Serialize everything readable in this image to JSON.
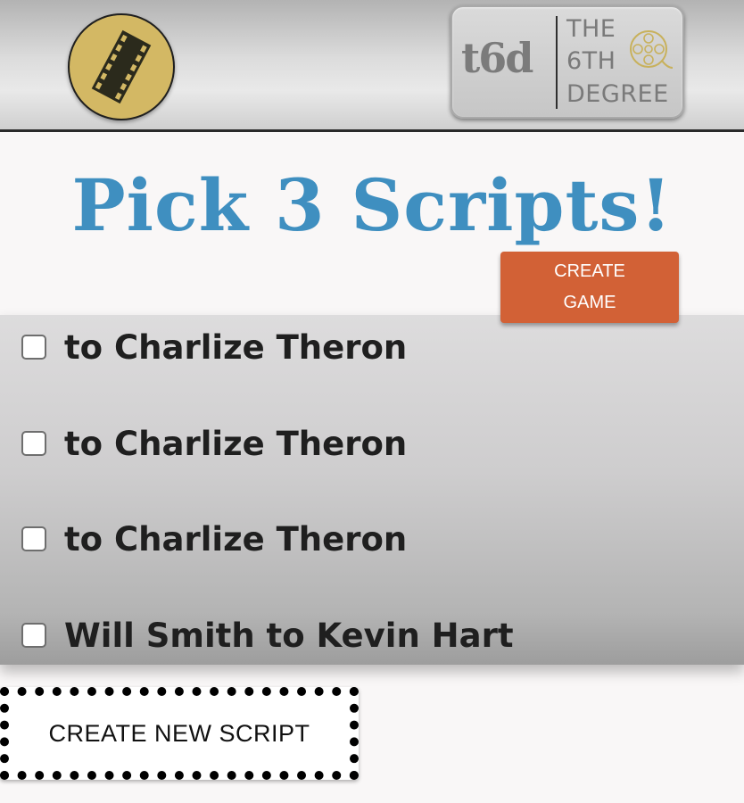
{
  "brand": {
    "mark": "t6d",
    "line1": "THE",
    "line2": "6TH",
    "line3": "DEGREE"
  },
  "icons": {
    "left_logo": "film-strip-icon",
    "brand_reel": "film-reel-icon"
  },
  "colors": {
    "title": "#3f8fc0",
    "create_game_bg": "#d26136",
    "logo_gold": "#d3b864"
  },
  "page": {
    "title": "Pick 3 Scripts!"
  },
  "create_game": {
    "line1": "CREATE",
    "line2": "GAME"
  },
  "scripts": [
    {
      "label": "to Charlize Theron",
      "checked": false
    },
    {
      "label": "to Charlize Theron",
      "checked": false
    },
    {
      "label": "to Charlize Theron",
      "checked": false
    },
    {
      "label": "Will Smith to Kevin Hart",
      "checked": false
    }
  ],
  "create_new_script": {
    "label": "CREATE NEW SCRIPT"
  }
}
